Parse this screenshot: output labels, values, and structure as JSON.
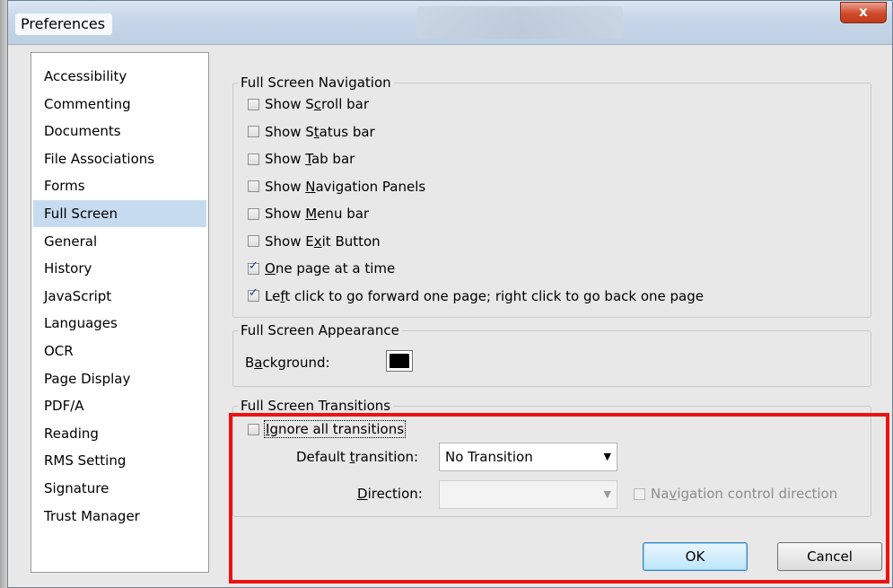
{
  "window": {
    "title": "Preferences",
    "close_label": "x"
  },
  "categories": [
    "Accessibility",
    "Commenting",
    "Documents",
    "File Associations",
    "Forms",
    "Full Screen",
    "General",
    "History",
    "JavaScript",
    "Languages",
    "OCR",
    "Page Display",
    "PDF/A",
    "Reading",
    "RMS Setting",
    "Signature",
    "Trust Manager"
  ],
  "selected_category": "Full Screen",
  "navigation": {
    "title": "Full Screen Navigation",
    "items": [
      {
        "pre": "Show S",
        "acc": "c",
        "post": "roll bar",
        "checked": false
      },
      {
        "pre": "Show S",
        "acc": "t",
        "post": "atus bar",
        "checked": false
      },
      {
        "pre": "Show ",
        "acc": "T",
        "post": "ab bar",
        "checked": false
      },
      {
        "pre": "Show ",
        "acc": "N",
        "post": "avigation Panels",
        "checked": false
      },
      {
        "pre": "Show ",
        "acc": "M",
        "post": "enu bar",
        "checked": false
      },
      {
        "pre": "Show E",
        "acc": "x",
        "post": "it Button",
        "checked": false
      },
      {
        "pre": "",
        "acc": "O",
        "post": "ne page at a time",
        "checked": true
      },
      {
        "pre": "Le",
        "acc": "f",
        "post": "t click to go forward one page; right click to go back one page",
        "checked": true
      }
    ]
  },
  "appearance": {
    "title": "Full Screen Appearance",
    "background_label_pre": "B",
    "background_label_acc": "a",
    "background_label_post": "ckground:",
    "background_color": "#000000"
  },
  "transitions": {
    "title": "Full Screen Transitions",
    "ignore_pre": "",
    "ignore_acc": "I",
    "ignore_post": "gnore all transitions",
    "ignore_checked": false,
    "default_label_pre": "Default ",
    "default_label_acc": "t",
    "default_label_post": "ransition:",
    "default_value": "No Transition",
    "direction_label_pre": "",
    "direction_label_acc": "D",
    "direction_label_post": "irection:",
    "direction_value": "",
    "nav_dir_pre": "Na",
    "nav_dir_acc": "v",
    "nav_dir_post": "igation control direction",
    "nav_dir_checked": false
  },
  "buttons": {
    "ok": "OK",
    "cancel": "Cancel"
  },
  "colors": {
    "highlight": "#ee1111",
    "selection": "#c7dbf0"
  }
}
